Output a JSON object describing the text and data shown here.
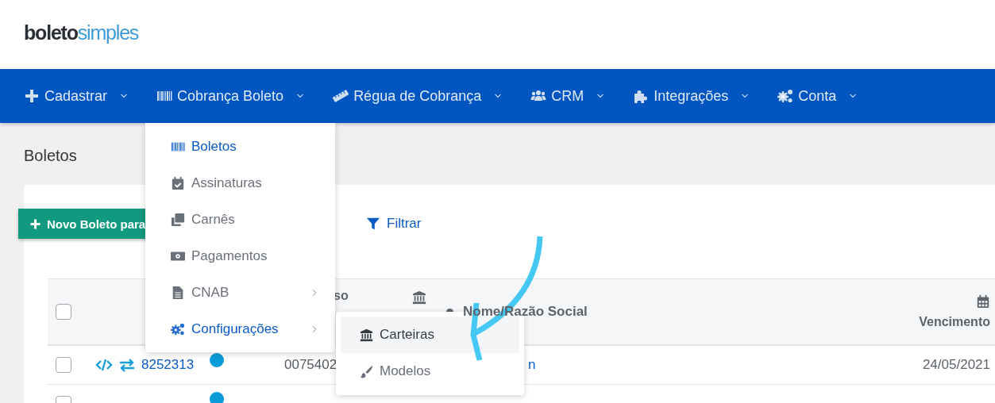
{
  "logo": {
    "part_1": "boleto",
    "part_2": "simples"
  },
  "nav": [
    {
      "label": "Cadastrar"
    },
    {
      "label": "Cobrança Boleto"
    },
    {
      "label": "Régua de Cobrança"
    },
    {
      "label": "CRM"
    },
    {
      "label": "Integrações"
    },
    {
      "label": "Conta"
    }
  ],
  "page_title": "Boletos",
  "toolbar": {
    "new_button": "Novo Boleto para",
    "filter_button": "Filtrar"
  },
  "table": {
    "header": {
      "checked": false,
      "column_4": "so",
      "name": "Nome/Razão Social",
      "due": "Vencimento"
    },
    "rows": [
      {
        "checked": false,
        "id": "8252313",
        "color": "#0a9cd8",
        "column_4": "0075402",
        "name": "n",
        "due": "24/05/2021"
      },
      {
        "checked": false,
        "color": "#0a9cd8"
      }
    ]
  },
  "dropdown": {
    "items": [
      {
        "label": "Boletos",
        "selected": true,
        "has_submenu": false
      },
      {
        "label": "Assinaturas",
        "selected": false,
        "has_submenu": false
      },
      {
        "label": "Carnês",
        "selected": false,
        "has_submenu": false
      },
      {
        "label": "Pagamentos",
        "selected": false,
        "has_submenu": false
      },
      {
        "label": "CNAB",
        "selected": false,
        "has_submenu": true
      },
      {
        "label": "Configurações",
        "selected": true,
        "has_submenu": true
      }
    ]
  },
  "submenu": {
    "items": [
      {
        "label": "Carteiras",
        "selected": true
      },
      {
        "label": "Modelos",
        "selected": false
      }
    ]
  }
}
